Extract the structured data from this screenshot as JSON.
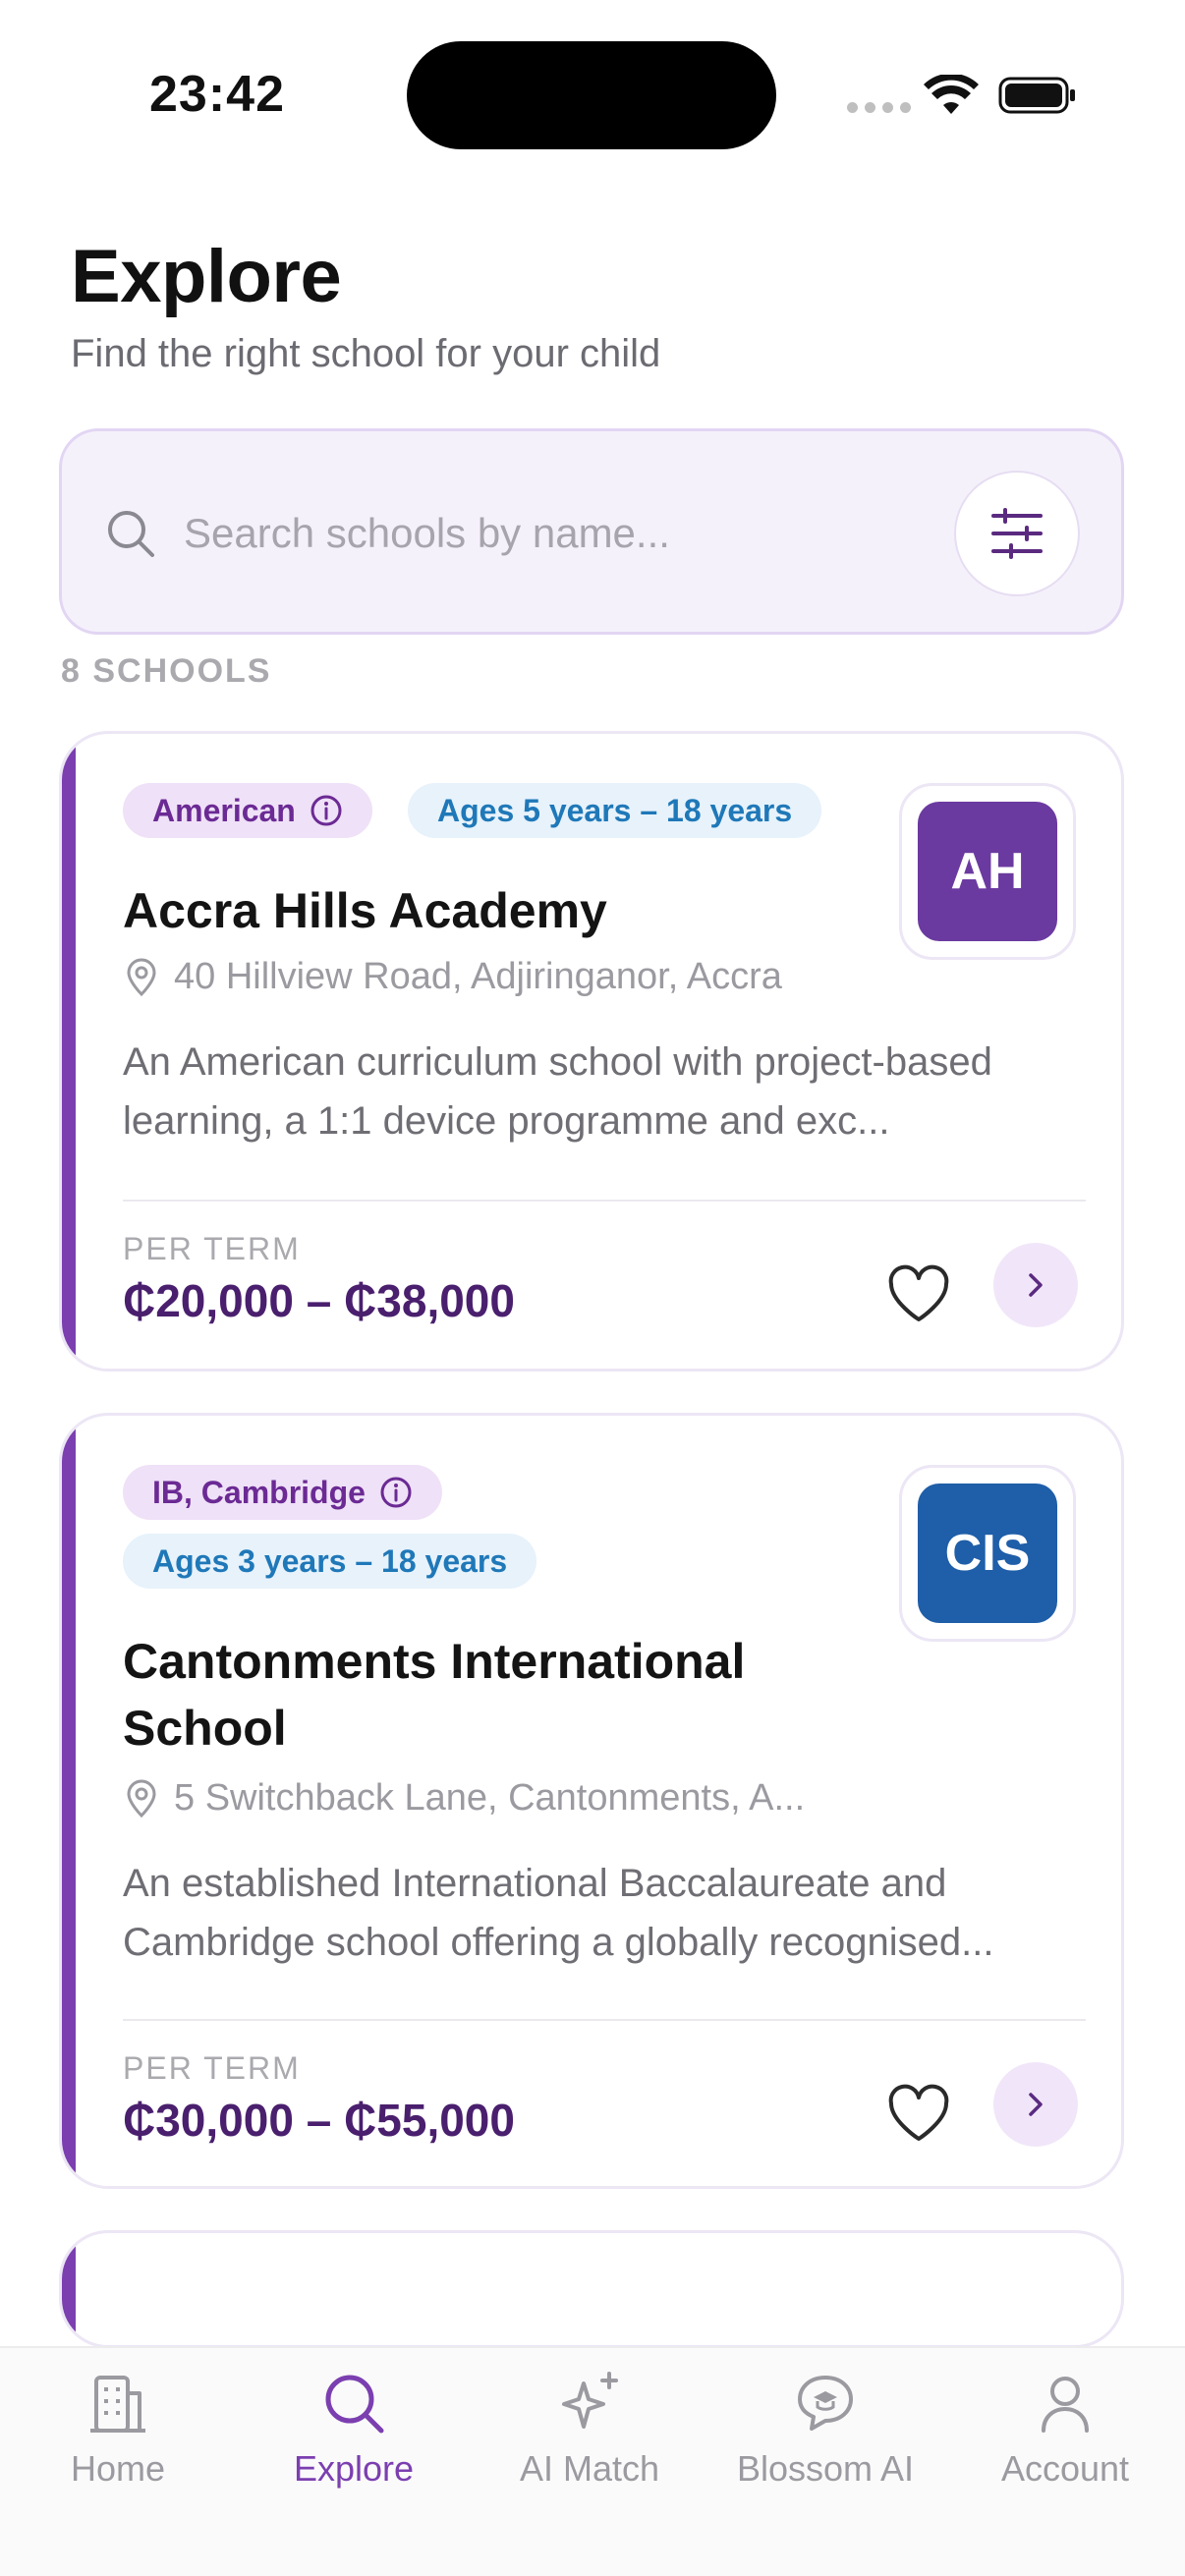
{
  "status_bar": {
    "time": "23:42"
  },
  "header": {
    "title": "Explore",
    "subtitle": "Find the right school for your child"
  },
  "search": {
    "placeholder": "Search schools by name...",
    "value": ""
  },
  "results": {
    "count_label": "8 SCHOOLS"
  },
  "schools": [
    {
      "curriculum": "American",
      "ages": "Ages 5 years – 18 years",
      "initials": "AH",
      "logo_color": "#6b3aa0",
      "name": "Accra Hills Academy",
      "address": "40 Hillview Road, Adjiringanor, Accra",
      "description": "An American curriculum school with project-based learning, a 1:1 device programme and exc...",
      "fee_period": "PER TERM",
      "fee_range": "₵20,000 – ₵38,000"
    },
    {
      "curriculum": "IB, Cambridge",
      "ages": "Ages 3 years – 18 years",
      "initials": "CIS",
      "logo_color": "#1f5ea8",
      "name": "Cantonments International School",
      "address": "5 Switchback Lane, Cantonments, A...",
      "description": "An established International Baccalaureate and Cambridge school offering a globally recognised...",
      "fee_period": "PER TERM",
      "fee_range": "₵30,000 – ₵55,000"
    }
  ],
  "tab_bar": {
    "items": [
      {
        "label": "Home",
        "icon": "building-icon",
        "active": false
      },
      {
        "label": "Explore",
        "icon": "search-icon",
        "active": true
      },
      {
        "label": "AI Match",
        "icon": "sparkles-icon",
        "active": false
      },
      {
        "label": "Blossom AI",
        "icon": "chat-bubble-icon",
        "active": false
      },
      {
        "label": "Account",
        "icon": "person-icon",
        "active": false
      }
    ]
  },
  "colors": {
    "accent": "#7b3fb0",
    "price": "#4a1f6e",
    "ages_tag_text": "#1f78b8"
  }
}
